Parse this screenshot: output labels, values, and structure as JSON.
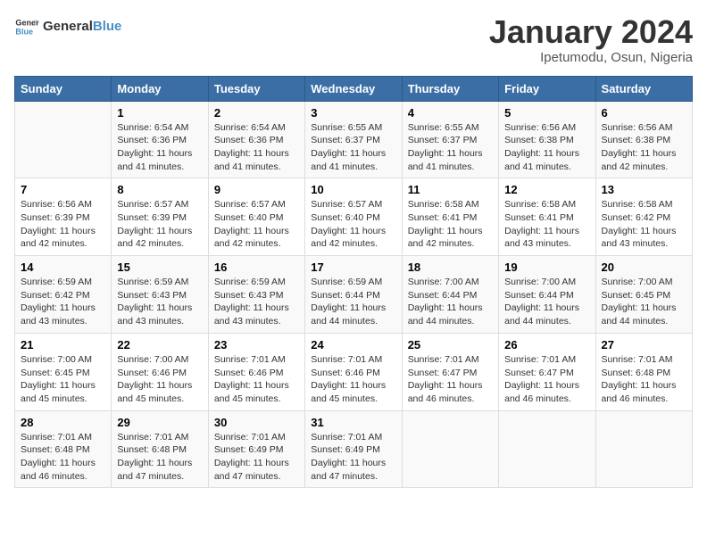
{
  "logo": {
    "name_part1": "General",
    "name_part2": "Blue"
  },
  "calendar": {
    "title": "January 2024",
    "subtitle": "Ipetumodu, Osun, Nigeria"
  },
  "headers": [
    "Sunday",
    "Monday",
    "Tuesday",
    "Wednesday",
    "Thursday",
    "Friday",
    "Saturday"
  ],
  "weeks": [
    [
      {
        "day": "",
        "sunrise": "",
        "sunset": "",
        "daylight": ""
      },
      {
        "day": "1",
        "sunrise": "Sunrise: 6:54 AM",
        "sunset": "Sunset: 6:36 PM",
        "daylight": "Daylight: 11 hours and 41 minutes."
      },
      {
        "day": "2",
        "sunrise": "Sunrise: 6:54 AM",
        "sunset": "Sunset: 6:36 PM",
        "daylight": "Daylight: 11 hours and 41 minutes."
      },
      {
        "day": "3",
        "sunrise": "Sunrise: 6:55 AM",
        "sunset": "Sunset: 6:37 PM",
        "daylight": "Daylight: 11 hours and 41 minutes."
      },
      {
        "day": "4",
        "sunrise": "Sunrise: 6:55 AM",
        "sunset": "Sunset: 6:37 PM",
        "daylight": "Daylight: 11 hours and 41 minutes."
      },
      {
        "day": "5",
        "sunrise": "Sunrise: 6:56 AM",
        "sunset": "Sunset: 6:38 PM",
        "daylight": "Daylight: 11 hours and 41 minutes."
      },
      {
        "day": "6",
        "sunrise": "Sunrise: 6:56 AM",
        "sunset": "Sunset: 6:38 PM",
        "daylight": "Daylight: 11 hours and 42 minutes."
      }
    ],
    [
      {
        "day": "7",
        "sunrise": "Sunrise: 6:56 AM",
        "sunset": "Sunset: 6:39 PM",
        "daylight": "Daylight: 11 hours and 42 minutes."
      },
      {
        "day": "8",
        "sunrise": "Sunrise: 6:57 AM",
        "sunset": "Sunset: 6:39 PM",
        "daylight": "Daylight: 11 hours and 42 minutes."
      },
      {
        "day": "9",
        "sunrise": "Sunrise: 6:57 AM",
        "sunset": "Sunset: 6:40 PM",
        "daylight": "Daylight: 11 hours and 42 minutes."
      },
      {
        "day": "10",
        "sunrise": "Sunrise: 6:57 AM",
        "sunset": "Sunset: 6:40 PM",
        "daylight": "Daylight: 11 hours and 42 minutes."
      },
      {
        "day": "11",
        "sunrise": "Sunrise: 6:58 AM",
        "sunset": "Sunset: 6:41 PM",
        "daylight": "Daylight: 11 hours and 42 minutes."
      },
      {
        "day": "12",
        "sunrise": "Sunrise: 6:58 AM",
        "sunset": "Sunset: 6:41 PM",
        "daylight": "Daylight: 11 hours and 43 minutes."
      },
      {
        "day": "13",
        "sunrise": "Sunrise: 6:58 AM",
        "sunset": "Sunset: 6:42 PM",
        "daylight": "Daylight: 11 hours and 43 minutes."
      }
    ],
    [
      {
        "day": "14",
        "sunrise": "Sunrise: 6:59 AM",
        "sunset": "Sunset: 6:42 PM",
        "daylight": "Daylight: 11 hours and 43 minutes."
      },
      {
        "day": "15",
        "sunrise": "Sunrise: 6:59 AM",
        "sunset": "Sunset: 6:43 PM",
        "daylight": "Daylight: 11 hours and 43 minutes."
      },
      {
        "day": "16",
        "sunrise": "Sunrise: 6:59 AM",
        "sunset": "Sunset: 6:43 PM",
        "daylight": "Daylight: 11 hours and 43 minutes."
      },
      {
        "day": "17",
        "sunrise": "Sunrise: 6:59 AM",
        "sunset": "Sunset: 6:44 PM",
        "daylight": "Daylight: 11 hours and 44 minutes."
      },
      {
        "day": "18",
        "sunrise": "Sunrise: 7:00 AM",
        "sunset": "Sunset: 6:44 PM",
        "daylight": "Daylight: 11 hours and 44 minutes."
      },
      {
        "day": "19",
        "sunrise": "Sunrise: 7:00 AM",
        "sunset": "Sunset: 6:44 PM",
        "daylight": "Daylight: 11 hours and 44 minutes."
      },
      {
        "day": "20",
        "sunrise": "Sunrise: 7:00 AM",
        "sunset": "Sunset: 6:45 PM",
        "daylight": "Daylight: 11 hours and 44 minutes."
      }
    ],
    [
      {
        "day": "21",
        "sunrise": "Sunrise: 7:00 AM",
        "sunset": "Sunset: 6:45 PM",
        "daylight": "Daylight: 11 hours and 45 minutes."
      },
      {
        "day": "22",
        "sunrise": "Sunrise: 7:00 AM",
        "sunset": "Sunset: 6:46 PM",
        "daylight": "Daylight: 11 hours and 45 minutes."
      },
      {
        "day": "23",
        "sunrise": "Sunrise: 7:01 AM",
        "sunset": "Sunset: 6:46 PM",
        "daylight": "Daylight: 11 hours and 45 minutes."
      },
      {
        "day": "24",
        "sunrise": "Sunrise: 7:01 AM",
        "sunset": "Sunset: 6:46 PM",
        "daylight": "Daylight: 11 hours and 45 minutes."
      },
      {
        "day": "25",
        "sunrise": "Sunrise: 7:01 AM",
        "sunset": "Sunset: 6:47 PM",
        "daylight": "Daylight: 11 hours and 46 minutes."
      },
      {
        "day": "26",
        "sunrise": "Sunrise: 7:01 AM",
        "sunset": "Sunset: 6:47 PM",
        "daylight": "Daylight: 11 hours and 46 minutes."
      },
      {
        "day": "27",
        "sunrise": "Sunrise: 7:01 AM",
        "sunset": "Sunset: 6:48 PM",
        "daylight": "Daylight: 11 hours and 46 minutes."
      }
    ],
    [
      {
        "day": "28",
        "sunrise": "Sunrise: 7:01 AM",
        "sunset": "Sunset: 6:48 PM",
        "daylight": "Daylight: 11 hours and 46 minutes."
      },
      {
        "day": "29",
        "sunrise": "Sunrise: 7:01 AM",
        "sunset": "Sunset: 6:48 PM",
        "daylight": "Daylight: 11 hours and 47 minutes."
      },
      {
        "day": "30",
        "sunrise": "Sunrise: 7:01 AM",
        "sunset": "Sunset: 6:49 PM",
        "daylight": "Daylight: 11 hours and 47 minutes."
      },
      {
        "day": "31",
        "sunrise": "Sunrise: 7:01 AM",
        "sunset": "Sunset: 6:49 PM",
        "daylight": "Daylight: 11 hours and 47 minutes."
      },
      {
        "day": "",
        "sunrise": "",
        "sunset": "",
        "daylight": ""
      },
      {
        "day": "",
        "sunrise": "",
        "sunset": "",
        "daylight": ""
      },
      {
        "day": "",
        "sunrise": "",
        "sunset": "",
        "daylight": ""
      }
    ]
  ]
}
